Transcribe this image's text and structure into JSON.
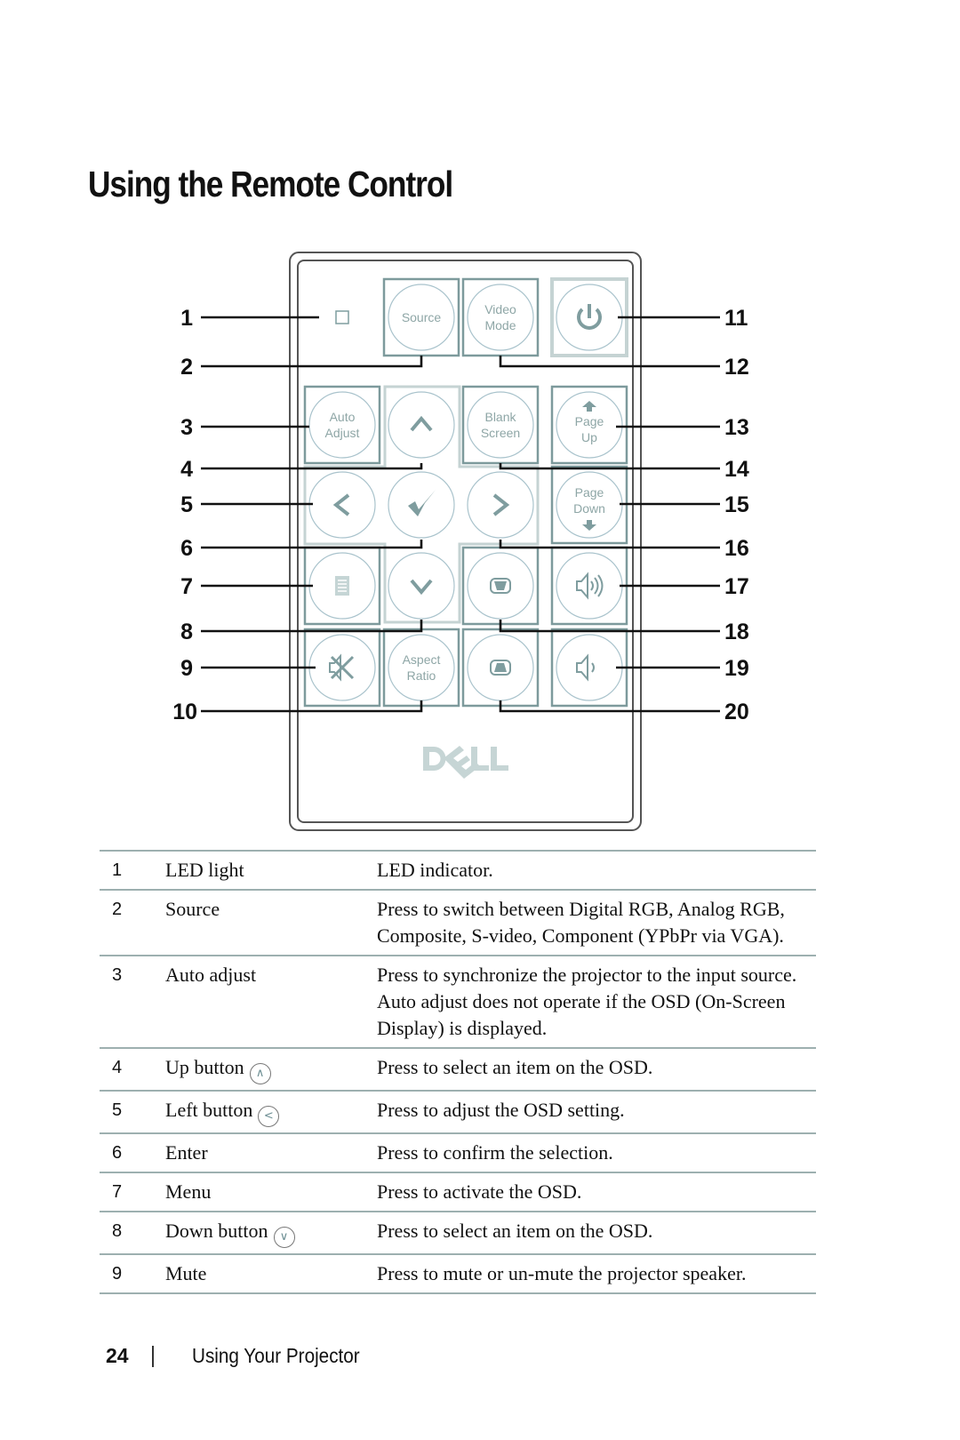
{
  "page_title": "Using the Remote Control",
  "remote": {
    "brand_logo": "DELL",
    "buttons": [
      {
        "id": 1,
        "kind": "led",
        "icon": "led-square-icon",
        "label": ""
      },
      {
        "id": 2,
        "kind": "text",
        "label_lines": [
          "Source"
        ]
      },
      {
        "id": 12,
        "kind": "text",
        "label_lines": [
          "Video",
          "Mode"
        ]
      },
      {
        "id": 11,
        "kind": "icon",
        "icon": "power-icon"
      },
      {
        "id": 3,
        "kind": "text",
        "label_lines": [
          "Auto",
          "Adjust"
        ]
      },
      {
        "id": 4,
        "kind": "icon",
        "icon": "chevron-up-icon"
      },
      {
        "id": 14,
        "kind": "text",
        "label_lines": [
          "Blank",
          "Screen"
        ]
      },
      {
        "id": 13,
        "kind": "text",
        "icon": "arrow-up-icon",
        "label_lines": [
          "Page",
          "Up"
        ]
      },
      {
        "id": 5,
        "kind": "icon",
        "icon": "chevron-left-icon"
      },
      {
        "id": 6,
        "kind": "icon",
        "icon": "checkmark-icon"
      },
      {
        "id": 16,
        "kind": "icon",
        "icon": "chevron-right-icon"
      },
      {
        "id": 15,
        "kind": "text",
        "icon": "arrow-down-icon",
        "label_lines": [
          "Page",
          "Down"
        ]
      },
      {
        "id": 7,
        "kind": "icon",
        "icon": "menu-icon"
      },
      {
        "id": 8,
        "kind": "icon",
        "icon": "chevron-down-icon"
      },
      {
        "id": 18,
        "kind": "icon",
        "icon": "keystone-down-icon"
      },
      {
        "id": 17,
        "kind": "icon",
        "icon": "volume-up-icon"
      },
      {
        "id": 9,
        "kind": "icon",
        "icon": "mute-icon"
      },
      {
        "id": 10,
        "kind": "text",
        "label_lines": [
          "Aspect",
          "Ratio"
        ]
      },
      {
        "id": 20,
        "kind": "icon",
        "icon": "keystone-up-icon"
      },
      {
        "id": 19,
        "kind": "icon",
        "icon": "volume-down-icon"
      }
    ],
    "callouts_left": [
      "1",
      "2",
      "3",
      "4",
      "5",
      "6",
      "7",
      "8",
      "9",
      "10"
    ],
    "callouts_right": [
      "11",
      "12",
      "13",
      "14",
      "15",
      "16",
      "17",
      "18",
      "19",
      "20"
    ]
  },
  "table": {
    "rows": [
      {
        "num": "1",
        "name": "LED light",
        "icon": null,
        "desc": "LED indicator."
      },
      {
        "num": "2",
        "name": "Source",
        "icon": null,
        "desc": "Press to switch between Digital RGB, Analog RGB, Composite, S-video, Component (YPbPr via VGA)."
      },
      {
        "num": "3",
        "name": "Auto adjust",
        "icon": null,
        "desc": "Press to synchronize the projector to the input source. Auto adjust does not operate if the OSD (On-Screen Display) is displayed."
      },
      {
        "num": "4",
        "name": "Up button",
        "icon": "chevron-up-icon",
        "desc": "Press to select an item on the OSD."
      },
      {
        "num": "5",
        "name": "Left button",
        "icon": "chevron-left-icon",
        "desc": "Press to adjust the OSD setting."
      },
      {
        "num": "6",
        "name": "Enter",
        "icon": null,
        "desc": "Press to confirm the selection."
      },
      {
        "num": "7",
        "name": "Menu",
        "icon": null,
        "desc": "Press to activate the OSD."
      },
      {
        "num": "8",
        "name": "Down button",
        "icon": "chevron-down-icon",
        "desc": "Press to select an item on the OSD."
      },
      {
        "num": "9",
        "name": "Mute",
        "icon": null,
        "desc": "Press to mute or un-mute the projector speaker."
      }
    ]
  },
  "footer": {
    "page_number": "24",
    "chapter": "Using Your Projector"
  },
  "colors": {
    "button_stroke": "#7d9a9c",
    "button_light": "#c5d3d3",
    "circle": "#a9c3cc",
    "rule": "#9db0b0"
  }
}
